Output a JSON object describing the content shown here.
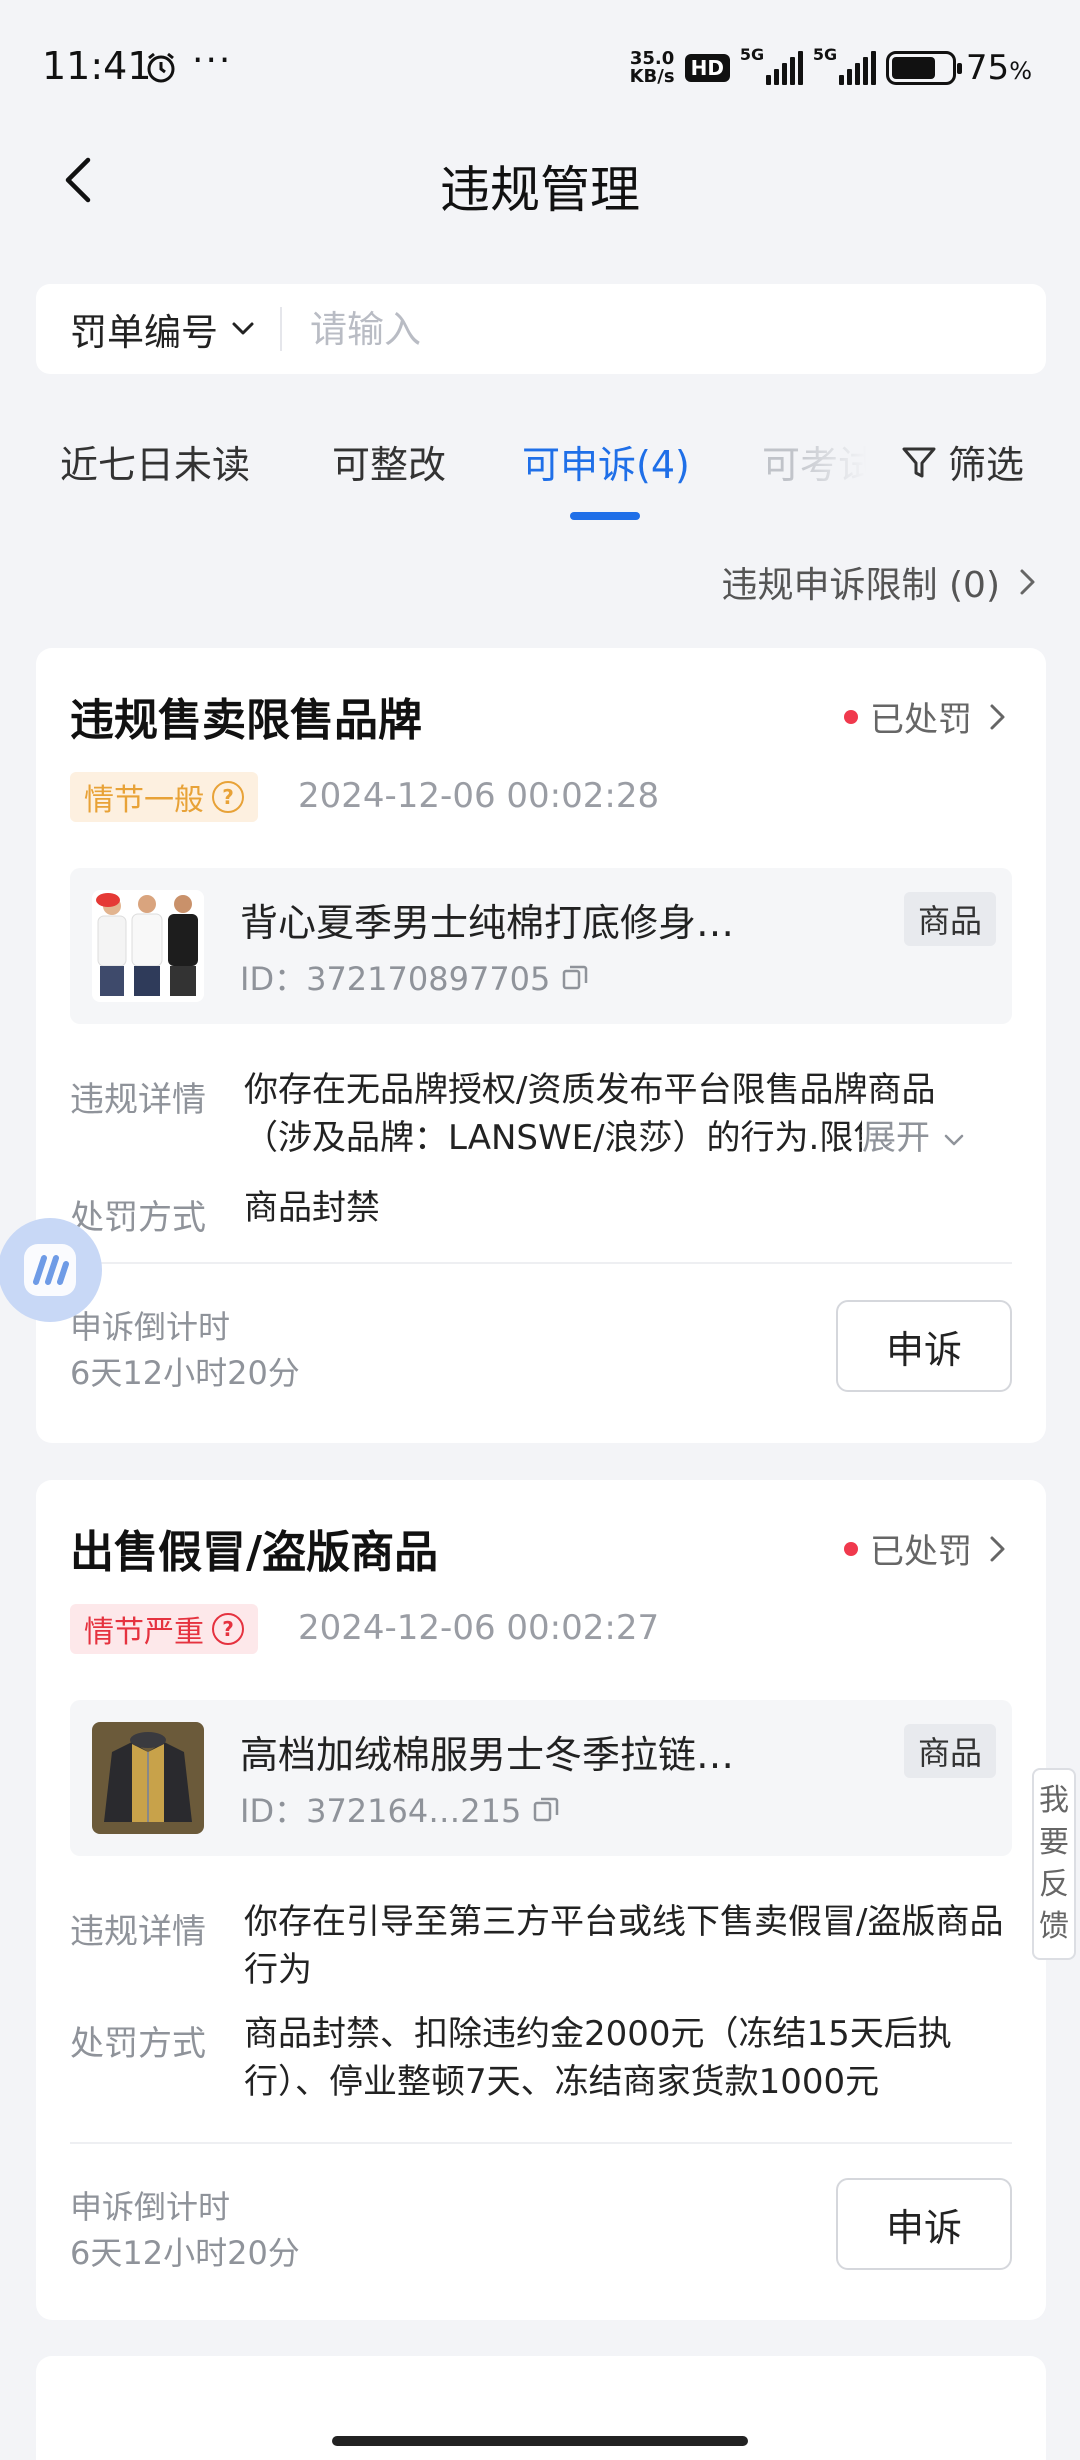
{
  "status_bar": {
    "time": "11:41",
    "net_speed_value": "35.0",
    "net_speed_unit": "KB/s",
    "hd": "HD",
    "signal1": "5G",
    "signal2": "5G",
    "battery_level": 0.75,
    "battery_pct": "75",
    "battery_unit": "%"
  },
  "header": {
    "title": "违规管理"
  },
  "search": {
    "type_label": "罚单编号",
    "placeholder": "请输入"
  },
  "tabs": [
    {
      "label": "近七日未读",
      "active": false
    },
    {
      "label": "可整改",
      "active": false
    },
    {
      "label": "可申诉(4)",
      "active": true
    },
    {
      "label": "可考试",
      "active": false
    }
  ],
  "filter_label": "筛选",
  "appeal_limit": "违规申诉限制 (0)",
  "colors": {
    "accent": "#1f6fe8",
    "status_dot": "#f0394d",
    "severity_normal": "#e8a237",
    "severity_serious": "#e5323f"
  },
  "cards": [
    {
      "title": "违规售卖限售品牌",
      "status": "已处罚",
      "severity": "情节一般",
      "time": "2024-12-06 00:02:28",
      "goods_name": "背心夏季男士纯棉打底修身…",
      "goods_id": "ID：372170897705",
      "goods_tag": "商品",
      "detail_label": "违规详情",
      "detail_line1": "你存在无品牌授权/资质发布平台限售品牌商品",
      "detail_line2": "（涉及品牌：LANSWE/浪莎）的行为.限售",
      "expand": "展开",
      "penalty_label": "处罚方式",
      "penalty": "商品封禁",
      "countdown_label": "申诉倒计时",
      "countdown": "6天12小时20分",
      "appeal_button": "申诉"
    },
    {
      "title": "出售假冒/盗版商品",
      "status": "已处罚",
      "severity": "情节严重",
      "time": "2024-12-06 00:02:27",
      "goods_name": "高档加绒棉服男士冬季拉链…",
      "goods_id": "ID：372164…215",
      "goods_tag": "商品",
      "detail_label": "违规详情",
      "detail": "你存在引导至第三方平台或线下售卖假冒/盗版商品行为",
      "penalty_label": "处罚方式",
      "penalty": "商品封禁、扣除违约金2000元（冻结15天后执行）、停业整顿7天、冻结商家货款1000元",
      "countdown_label": "申诉倒计时",
      "countdown": "6天12小时20分",
      "appeal_button": "申诉"
    }
  ],
  "feedback_label": "我要反馈"
}
